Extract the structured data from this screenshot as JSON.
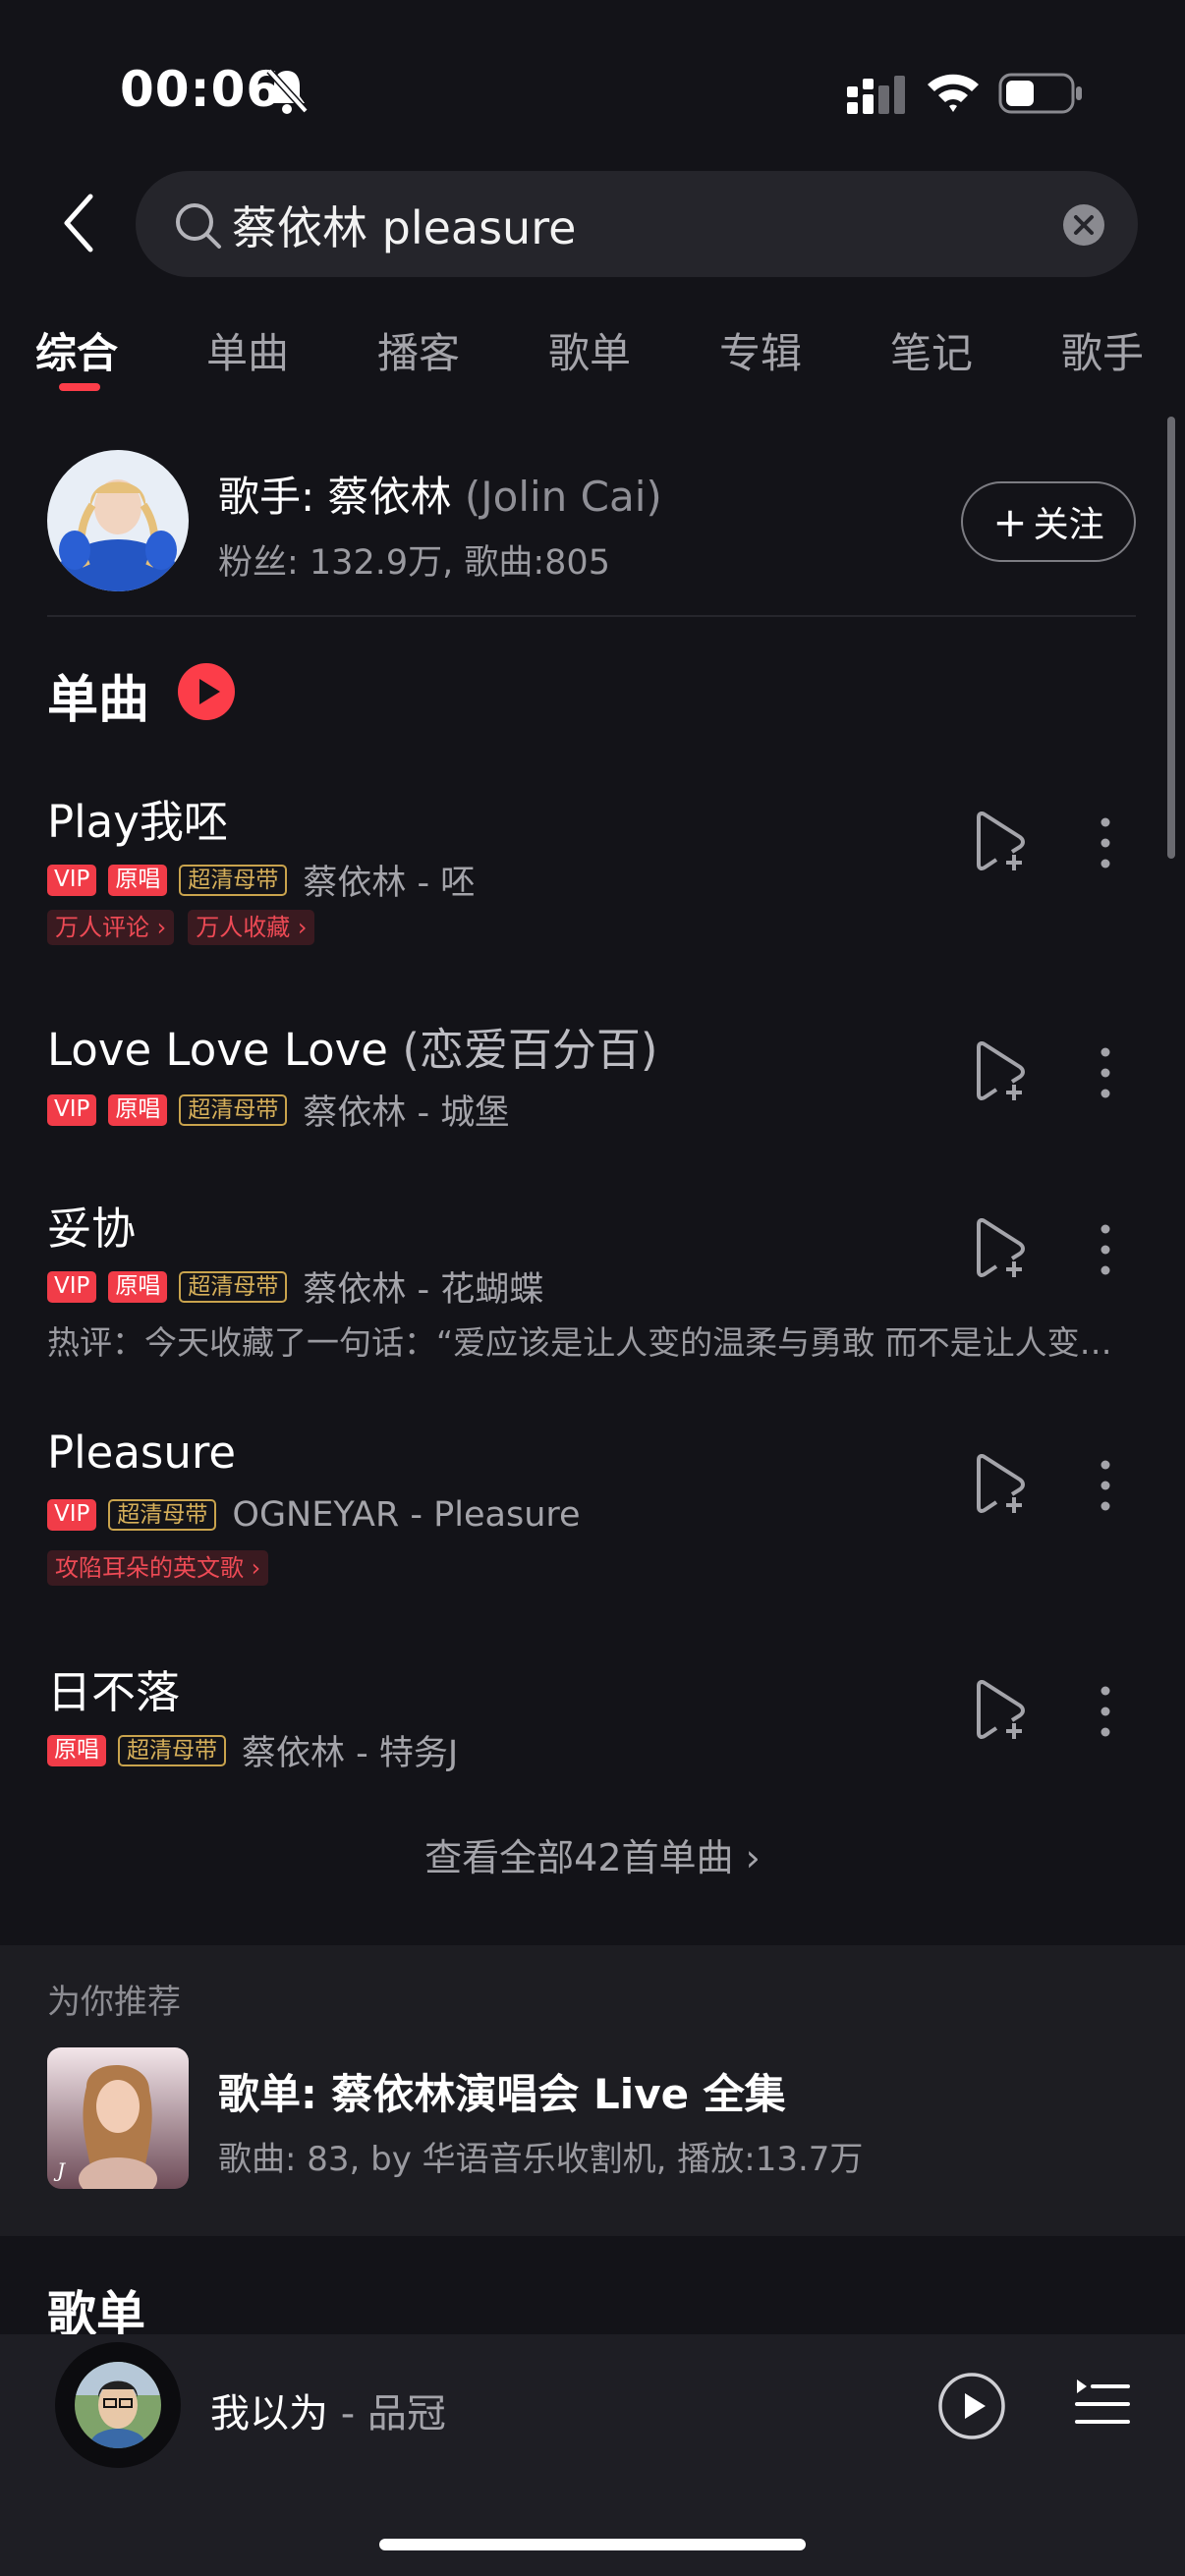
{
  "status_bar": {
    "time": "00:06",
    "icons": [
      "bell-muted-icon",
      "signal-icon",
      "wifi-icon",
      "battery-icon"
    ]
  },
  "search": {
    "query": "蔡依林 pleasure",
    "icons": [
      "back-chevron-icon",
      "search-icon",
      "clear-icon"
    ]
  },
  "tabs": [
    "综合",
    "单曲",
    "播客",
    "歌单",
    "专辑",
    "笔记",
    "歌手"
  ],
  "active_tab": "综合",
  "artist": {
    "title": "歌手: 蔡依林",
    "english_name": "(Jolin Cai)",
    "stats": "粉丝: 132.9万, 歌曲:805",
    "follow_label": "关注",
    "follow_prefix": "+"
  },
  "singles_section": {
    "title": "单曲",
    "view_all": "查看全部42首单曲",
    "view_all_chevron": "›"
  },
  "songs": [
    {
      "title": "Play我呸",
      "badges": [
        "VIP",
        "原唱",
        "超清母带"
      ],
      "artist_album": "蔡依林 - 呸",
      "tags": [
        "万人评论",
        "万人收藏"
      ]
    },
    {
      "title": "Love Love Love",
      "title_paren": "(恋爱百分百)",
      "badges": [
        "VIP",
        "原唱",
        "超清母带"
      ],
      "artist_album": "蔡依林 - 城堡"
    },
    {
      "title": "妥协",
      "badges": [
        "VIP",
        "原唱",
        "超清母带"
      ],
      "artist_album": "蔡依林 - 花蝴蝶",
      "hot_comment": "热评：今天收藏了一句话：“爱应该是让人变的温柔与勇敢 而不是让人变的卑微与脆弱”"
    },
    {
      "title": "Pleasure",
      "badges": [
        "VIP",
        "超清母带"
      ],
      "artist_album": "OGNEYAR - Pleasure",
      "tags": [
        "攻陷耳朵的英文歌"
      ]
    },
    {
      "title": "日不落",
      "badges": [
        "原唱",
        "超清母带"
      ],
      "artist_album": "蔡依林 - 特务J"
    }
  ],
  "recommend": {
    "label": "为你推荐",
    "playlist_title": "歌单: 蔡依林演唱会 Live 全集",
    "playlist_meta": "歌曲: 83, by 华语音乐收割机, 播放:13.7万"
  },
  "playlists_section": {
    "title": "歌单"
  },
  "player": {
    "song": "我以为",
    "separator": " - ",
    "artist": "品冠"
  },
  "colors": {
    "background": "#131318",
    "accent": "#fc3d49",
    "badge_red": "#f13c48",
    "badge_gold": "#c9a34d",
    "muted_text": "#a4a4aa"
  }
}
